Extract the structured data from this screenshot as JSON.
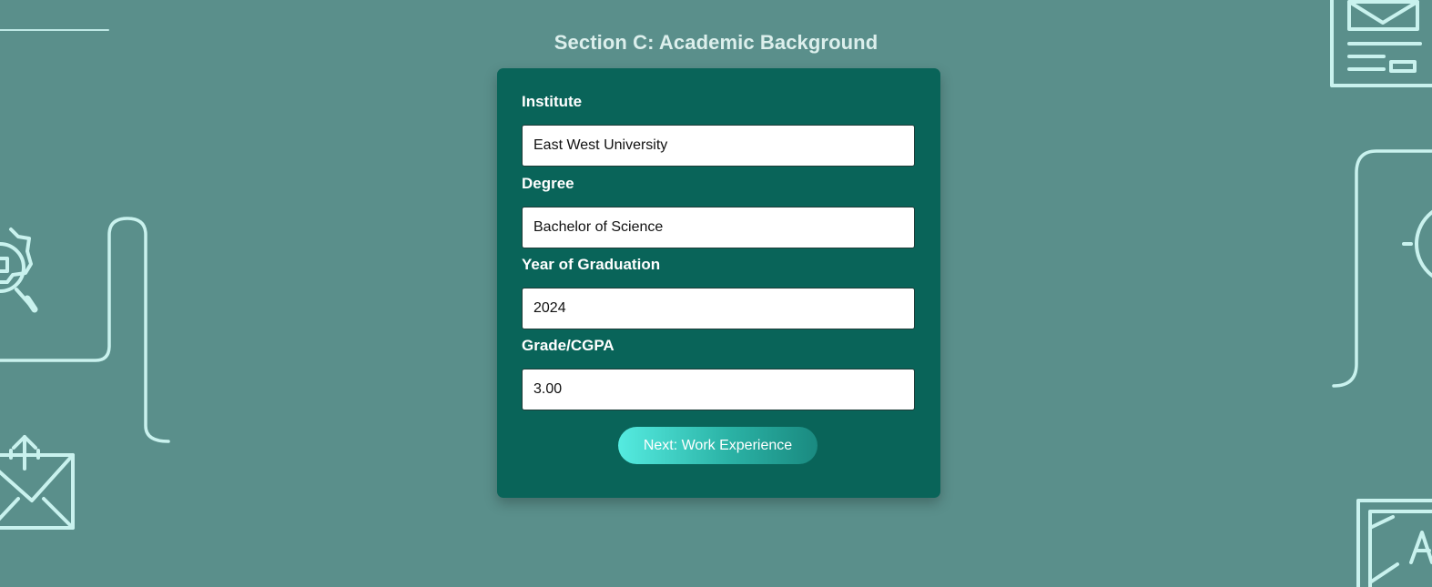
{
  "page": {
    "section_title": "Section C: Academic Background"
  },
  "form": {
    "fields": [
      {
        "label": "Institute",
        "value": "East West University"
      },
      {
        "label": "Degree",
        "value": "Bachelor of Science"
      },
      {
        "label": "Year of Graduation",
        "value": "2024"
      },
      {
        "label": "Grade/CGPA",
        "value": "3.00"
      }
    ],
    "next_button_label": "Next: Work Experience"
  },
  "background_icons": [
    "envelope-icon",
    "gear-search-icon",
    "mail-upload-icon",
    "newspaper-icon",
    "clock-icon",
    "presentation-board-icon"
  ],
  "colors": {
    "page_background": "#5a8f8b",
    "card_background": "#096459",
    "line_art": "#c9f2ee",
    "button_gradient_start": "#55ebe0",
    "button_gradient_end": "#1a8a80"
  }
}
